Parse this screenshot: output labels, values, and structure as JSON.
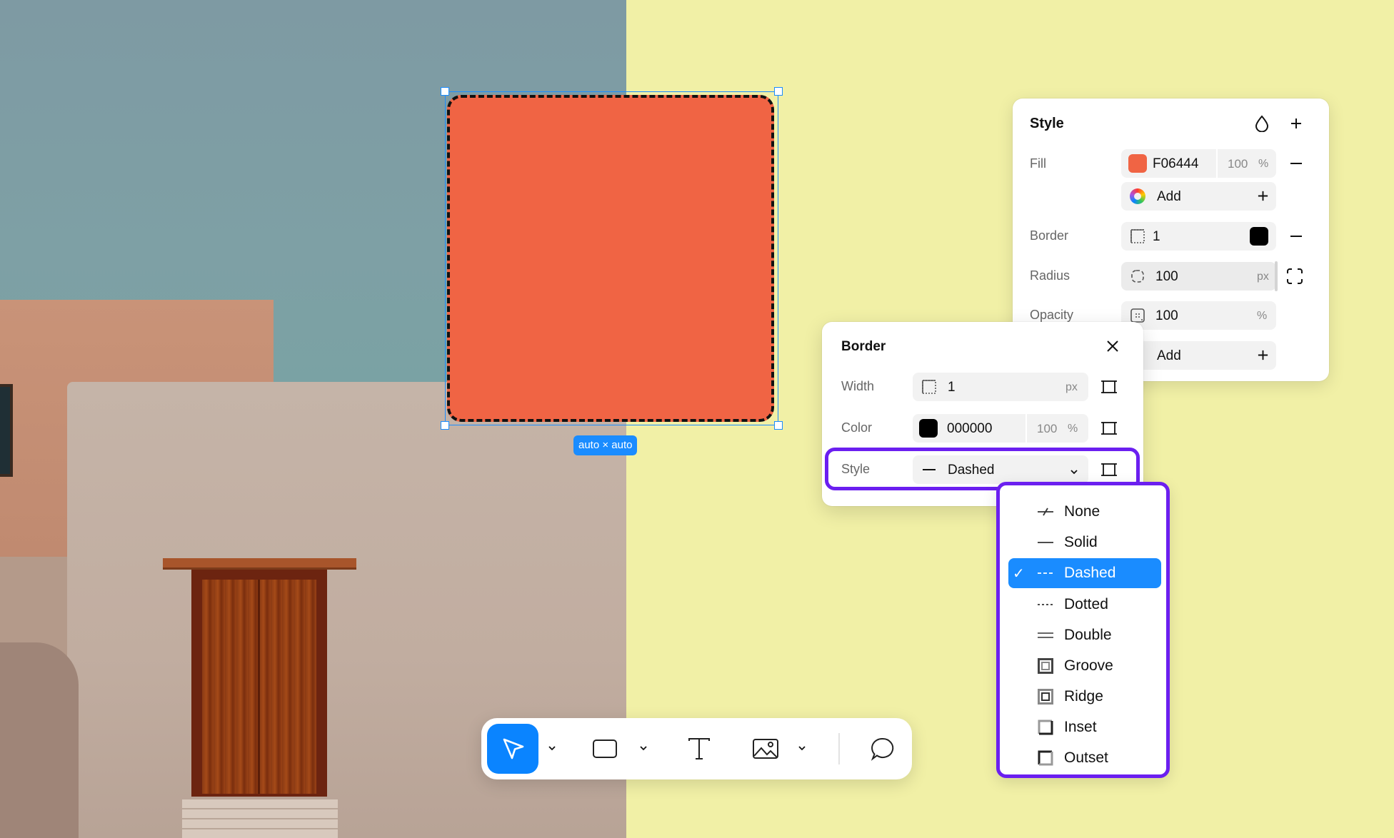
{
  "canvas": {
    "selection_size_label": "auto × auto",
    "shape_fill": "#F06444"
  },
  "style_panel": {
    "title": "Style",
    "fill": {
      "label": "Fill",
      "hex": "F06444",
      "opacity": "100",
      "opacity_unit": "%",
      "swatch": "#F06444"
    },
    "fill_add": {
      "label": "Add"
    },
    "border": {
      "label": "Border",
      "width": "1",
      "swatch": "#000000"
    },
    "radius": {
      "label": "Radius",
      "value": "100",
      "unit": "px"
    },
    "opacity": {
      "label": "Opacity",
      "value": "100",
      "unit": "%"
    },
    "effects_add": {
      "label": "Add"
    }
  },
  "border_panel": {
    "title": "Border",
    "width": {
      "label": "Width",
      "value": "1",
      "unit": "px"
    },
    "color": {
      "label": "Color",
      "hex": "000000",
      "opacity": "100",
      "opacity_unit": "%",
      "swatch": "#000000"
    },
    "style": {
      "label": "Style",
      "value": "Dashed"
    }
  },
  "style_dropdown": {
    "selected": "Dashed",
    "options": [
      {
        "label": "None",
        "icon": "none-line-icon"
      },
      {
        "label": "Solid",
        "icon": "solid-line-icon"
      },
      {
        "label": "Dashed",
        "icon": "dashed-line-icon"
      },
      {
        "label": "Dotted",
        "icon": "dotted-line-icon"
      },
      {
        "label": "Double",
        "icon": "double-line-icon"
      },
      {
        "label": "Groove",
        "icon": "groove-box-icon"
      },
      {
        "label": "Ridge",
        "icon": "ridge-box-icon"
      },
      {
        "label": "Inset",
        "icon": "inset-box-icon"
      },
      {
        "label": "Outset",
        "icon": "outset-box-icon"
      }
    ]
  },
  "toolbar": {
    "tools": [
      "select-tool",
      "rectangle-tool",
      "text-tool",
      "image-tool",
      "comment-tool"
    ],
    "active_tool": "select-tool",
    "accent": "#0A84FF"
  },
  "colors": {
    "accent": "#1A8CFF",
    "highlight": "#6B1FF0",
    "background_yellow": "#F1F0A6"
  }
}
